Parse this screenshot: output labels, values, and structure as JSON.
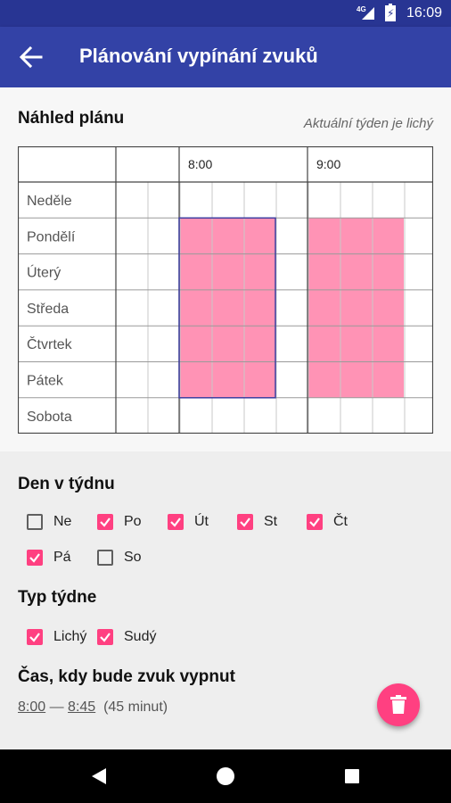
{
  "status_bar": {
    "time": "16:09",
    "network": "4G"
  },
  "app_bar": {
    "title": "Plánování vypínání zvuků"
  },
  "preview": {
    "title": "Náhled plánu",
    "week_note": "Aktuální týden je lichý",
    "time_headers": [
      "8:00",
      "9:00"
    ],
    "days": [
      "Neděle",
      "Pondělí",
      "Úterý",
      "Středa",
      "Čtvrtek",
      "Pátek",
      "Sobota"
    ],
    "colors": {
      "block_fill": "#ff80a8",
      "selected_border": "#3f3ea0",
      "grid": "#444444"
    },
    "blocks": [
      {
        "first_day": "Pondělí",
        "last_day": "Pátek",
        "start": "8:00",
        "end": "8:45",
        "selected": true
      },
      {
        "first_day": "Pondělí",
        "last_day": "Pátek",
        "start": "9:00",
        "end": "9:45",
        "selected": false
      }
    ]
  },
  "day_of_week": {
    "title": "Den v týdnu",
    "items": [
      {
        "label": "Ne",
        "checked": false
      },
      {
        "label": "Po",
        "checked": true
      },
      {
        "label": "Út",
        "checked": true
      },
      {
        "label": "St",
        "checked": true
      },
      {
        "label": "Čt",
        "checked": true
      },
      {
        "label": "Pá",
        "checked": true
      },
      {
        "label": "So",
        "checked": false
      }
    ]
  },
  "week_type": {
    "title": "Typ týdne",
    "items": [
      {
        "label": "Lichý",
        "checked": true
      },
      {
        "label": "Sudý",
        "checked": true
      }
    ]
  },
  "mute_time": {
    "title": "Čas, kdy bude zvuk vypnut",
    "start": "8:00",
    "dash": "—",
    "end": "8:45",
    "duration": "(45 minut)"
  },
  "fab": {
    "icon": "delete-icon",
    "color": "#ff4081"
  },
  "colors": {
    "primary": "#3342a6",
    "primary_dark": "#283593",
    "accent": "#ff4081"
  }
}
